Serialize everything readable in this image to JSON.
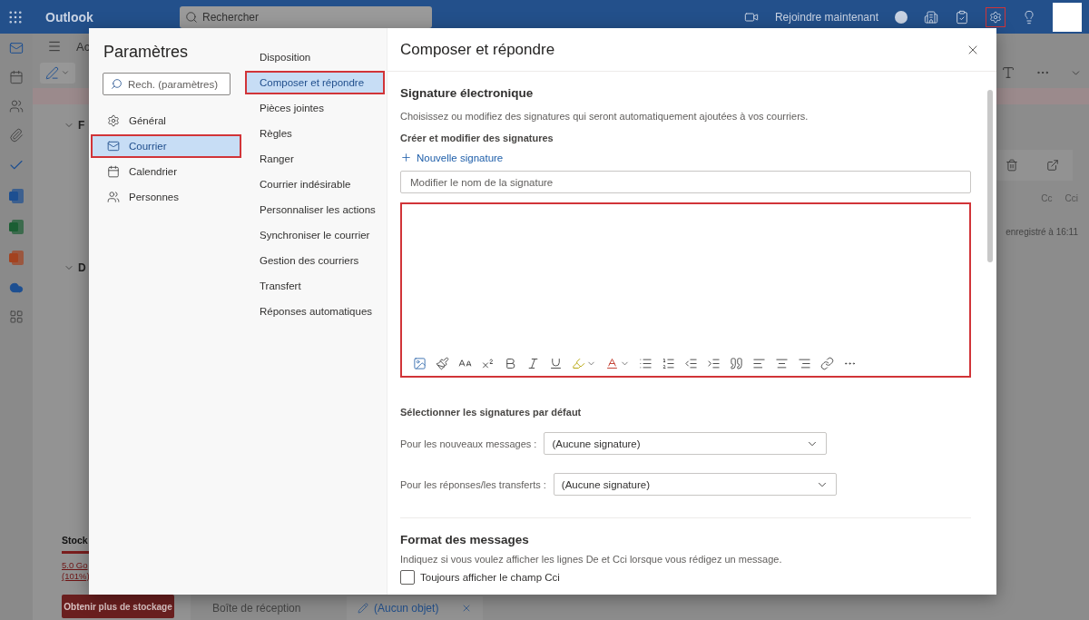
{
  "top_bar": {
    "app_name": "Outlook",
    "search": {
      "placeholder": "Rechercher"
    },
    "meeting_button": "Rejoindre maintenant",
    "settings_outlined": true
  },
  "mail_pane": {
    "header_text": "Ac",
    "folder_groups": [
      "F",
      "D"
    ],
    "storage": {
      "title": "Stock",
      "level": 1,
      "usage": "5.0 Go",
      "percent": "(101%)",
      "button": "Obtenir plus de stockage"
    }
  },
  "compose_pane": {
    "recipient_options": [
      "Cc",
      "Cci"
    ],
    "save_status": "enregistré à 16:11"
  },
  "bottom_tabs": [
    {
      "label": "Boîte de réception",
      "kind": "folder"
    },
    {
      "label": "(Aucun objet)",
      "kind": "draft"
    }
  ],
  "settings": {
    "title": "Paramètres",
    "search": {
      "placeholder": "Rech. (paramètres)"
    },
    "categories": [
      {
        "label": "Général",
        "selected": false,
        "outlined": false
      },
      {
        "label": "Courrier",
        "selected": true,
        "outlined": true
      },
      {
        "label": "Calendrier",
        "selected": false,
        "outlined": false
      },
      {
        "label": "Personnes",
        "selected": false,
        "outlined": false
      }
    ],
    "subcategories": [
      {
        "label": "Disposition",
        "selected": false,
        "outlined": false
      },
      {
        "label": "Composer et répondre",
        "selected": true,
        "outlined": true
      },
      {
        "label": "Pièces jointes",
        "selected": false,
        "outlined": false
      },
      {
        "label": "Règles",
        "selected": false,
        "outlined": false
      },
      {
        "label": "Ranger",
        "selected": false,
        "outlined": false
      },
      {
        "label": "Courrier indésirable",
        "selected": false,
        "outlined": false
      },
      {
        "label": "Personnaliser les actions",
        "selected": false,
        "outlined": false
      },
      {
        "label": "Synchroniser le courrier",
        "selected": false,
        "outlined": false
      },
      {
        "label": "Gestion des courriers",
        "selected": false,
        "outlined": false
      },
      {
        "label": "Transfert",
        "selected": false,
        "outlined": false
      },
      {
        "label": "Réponses automatiques",
        "selected": false,
        "outlined": false
      }
    ],
    "panel": {
      "title": "Composer et répondre",
      "signature": {
        "heading": "Signature électronique",
        "description": "Choisissez ou modifiez des signatures qui seront automatiquement ajoutées à vos courriers.",
        "subheading": "Créer et modifier des signatures",
        "new_button": "Nouvelle signature",
        "name_field": {
          "placeholder": "Modifier le nom de la signature"
        },
        "editor_outlined": true
      },
      "defaults": {
        "heading": "Sélectionner les signatures par défaut",
        "rows": [
          {
            "label": "Pour les nouveaux messages :",
            "value": "(Aucune signature)"
          },
          {
            "label": "Pour les réponses/les transferts :",
            "value": "(Aucune signature)"
          }
        ]
      },
      "format": {
        "heading": "Format des messages",
        "description": "Indiquez si vous voulez afficher les lignes De et Cci lorsque vous rédigez un message.",
        "options": [
          {
            "label": "Toujours afficher le champ Cci",
            "checked": false
          }
        ]
      }
    }
  }
}
